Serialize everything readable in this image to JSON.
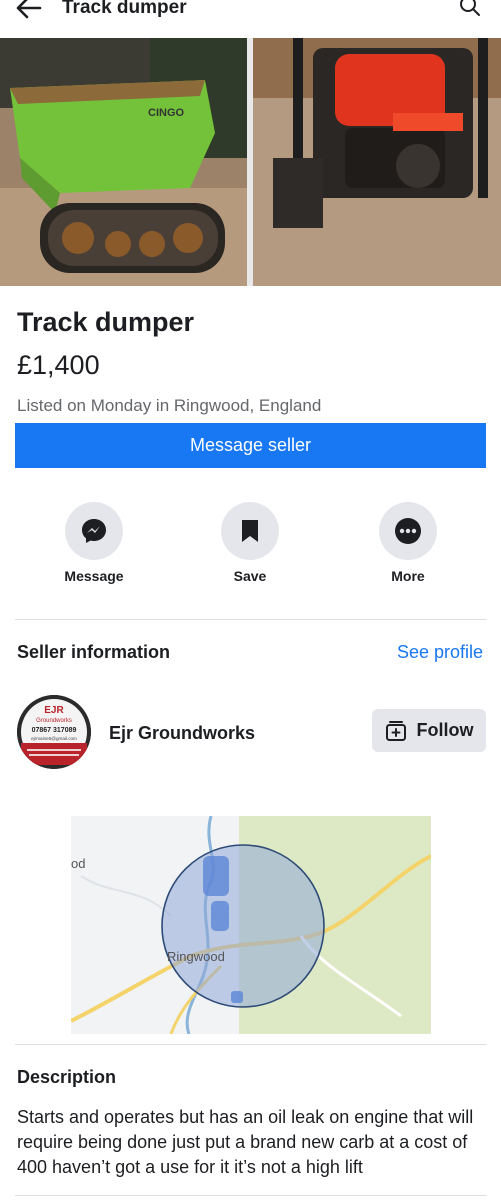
{
  "header": {
    "title": "Track dumper",
    "back_icon": "arrow-left-icon",
    "search_icon": "search-icon"
  },
  "listing": {
    "title": "Track dumper",
    "price": "£1,400",
    "listed": "Listed on Monday in Ringwood, England",
    "message_seller_label": "Message seller",
    "photo_1_brand": "CINGO"
  },
  "actions": [
    {
      "label": "Message",
      "icon": "messenger-icon"
    },
    {
      "label": "Save",
      "icon": "bookmark-icon"
    },
    {
      "label": "More",
      "icon": "more-dots-icon"
    }
  ],
  "seller": {
    "heading": "Seller information",
    "see_profile": "See profile",
    "name": "Ejr Groundworks",
    "follow_label": "Follow",
    "avatar_logo": {
      "line1": "EJR",
      "line2": "Groundworks",
      "phone": "07867 317089",
      "email": "ejrmaine5@gmail.com"
    }
  },
  "map": {
    "place_label": "Ringwood",
    "edge_label": "od"
  },
  "description": {
    "heading": "Description",
    "text": "Starts and operates but has an oil leak on engine that will require being done just put a brand new carb at a cost of 400 haven’t got a use for it it’s not a high lift"
  },
  "colors": {
    "primary": "#1877f2",
    "secondary_button": "#e4e6eb",
    "muted_text": "#65676b",
    "divider": "#dadde1"
  }
}
